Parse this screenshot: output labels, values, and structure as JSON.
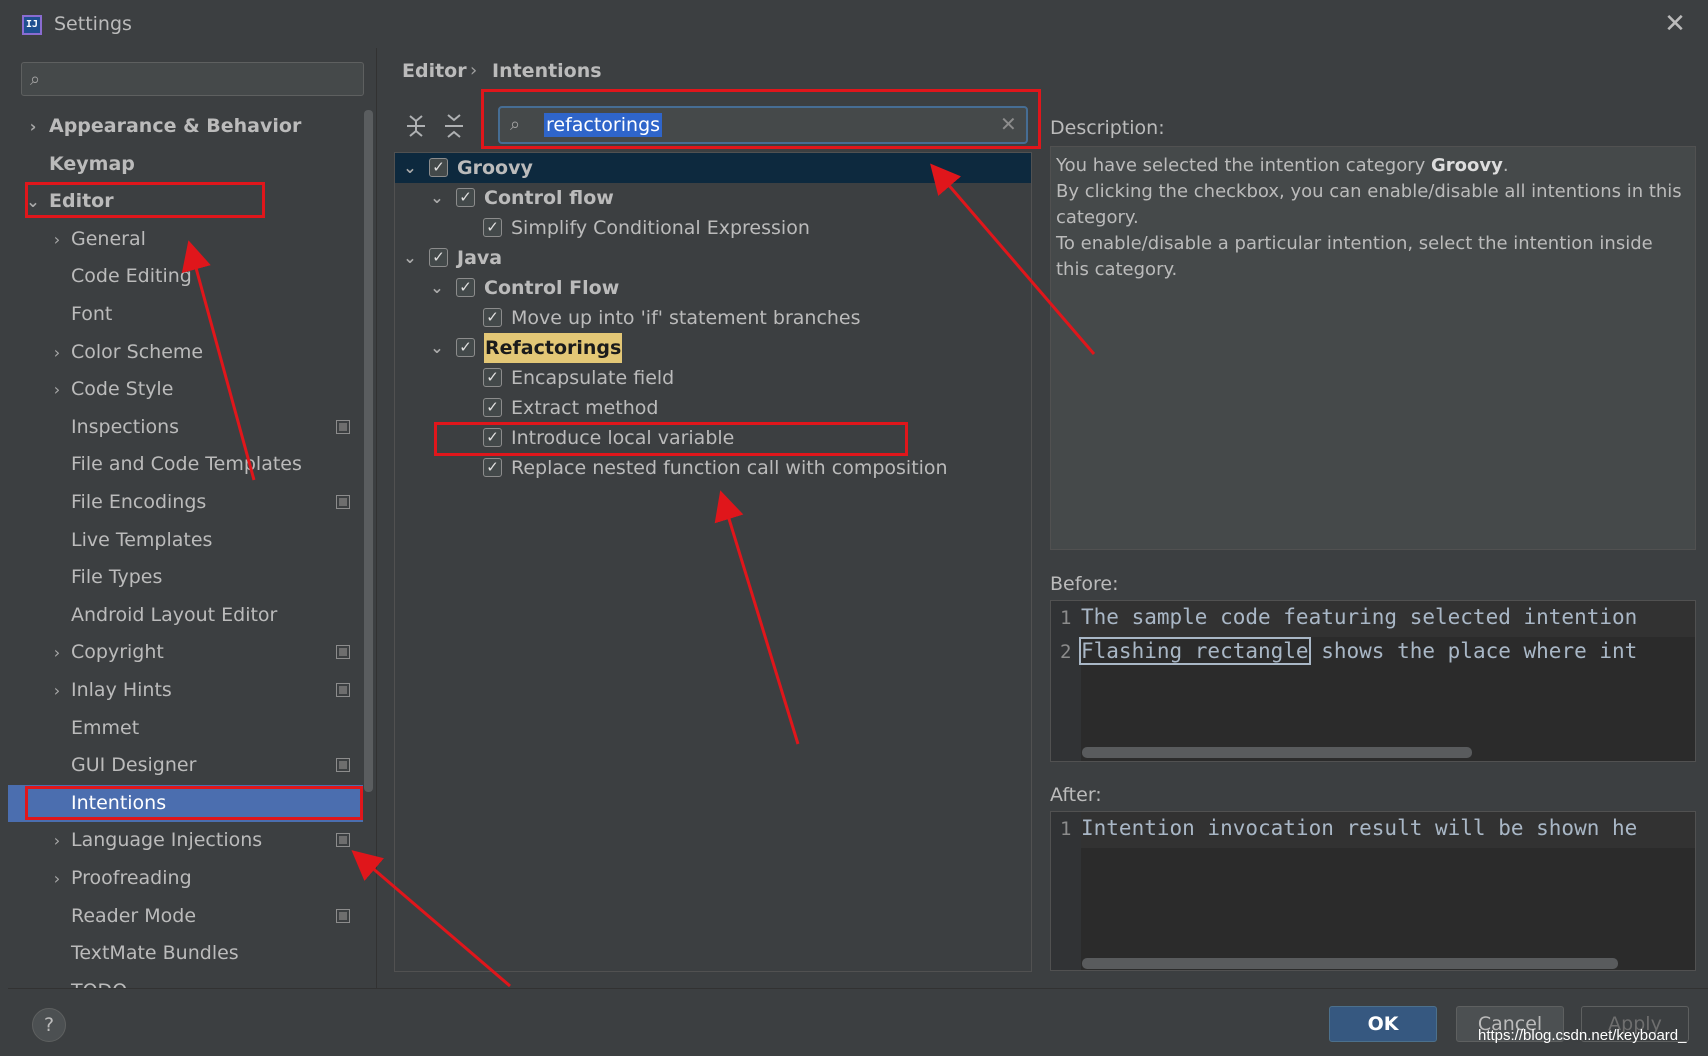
{
  "window": {
    "title": "Settings",
    "app_icon": "IJ",
    "close_glyph": "✕"
  },
  "left": {
    "search_placeholder": "",
    "tree": [
      {
        "label": "Appearance & Behavior",
        "level": 0,
        "bold": true,
        "chevron": "›",
        "icon": false
      },
      {
        "label": "Keymap",
        "level": 0,
        "bold": true,
        "chevron": "",
        "icon": false
      },
      {
        "label": "Editor",
        "level": 0,
        "bold": true,
        "chevron": "⌄",
        "icon": false
      },
      {
        "label": "General",
        "level": 1,
        "bold": false,
        "chevron": "›",
        "icon": false
      },
      {
        "label": "Code Editing",
        "level": 1,
        "bold": false,
        "chevron": "",
        "icon": false
      },
      {
        "label": "Font",
        "level": 1,
        "bold": false,
        "chevron": "",
        "icon": false
      },
      {
        "label": "Color Scheme",
        "level": 1,
        "bold": false,
        "chevron": "›",
        "icon": false
      },
      {
        "label": "Code Style",
        "level": 1,
        "bold": false,
        "chevron": "›",
        "icon": false
      },
      {
        "label": "Inspections",
        "level": 1,
        "bold": false,
        "chevron": "",
        "icon": true
      },
      {
        "label": "File and Code Templates",
        "level": 1,
        "bold": false,
        "chevron": "",
        "icon": false
      },
      {
        "label": "File Encodings",
        "level": 1,
        "bold": false,
        "chevron": "",
        "icon": true
      },
      {
        "label": "Live Templates",
        "level": 1,
        "bold": false,
        "chevron": "",
        "icon": false
      },
      {
        "label": "File Types",
        "level": 1,
        "bold": false,
        "chevron": "",
        "icon": false
      },
      {
        "label": "Android Layout Editor",
        "level": 1,
        "bold": false,
        "chevron": "",
        "icon": false
      },
      {
        "label": "Copyright",
        "level": 1,
        "bold": false,
        "chevron": "›",
        "icon": true
      },
      {
        "label": "Inlay Hints",
        "level": 1,
        "bold": false,
        "chevron": "›",
        "icon": true
      },
      {
        "label": "Emmet",
        "level": 1,
        "bold": false,
        "chevron": "",
        "icon": false
      },
      {
        "label": "GUI Designer",
        "level": 1,
        "bold": false,
        "chevron": "",
        "icon": true
      },
      {
        "label": "Intentions",
        "level": 1,
        "bold": false,
        "chevron": "",
        "icon": false,
        "selected": true
      },
      {
        "label": "Language Injections",
        "level": 1,
        "bold": false,
        "chevron": "›",
        "icon": true
      },
      {
        "label": "Proofreading",
        "level": 1,
        "bold": false,
        "chevron": "›",
        "icon": false
      },
      {
        "label": "Reader Mode",
        "level": 1,
        "bold": false,
        "chevron": "",
        "icon": true
      },
      {
        "label": "TextMate Bundles",
        "level": 1,
        "bold": false,
        "chevron": "",
        "icon": false
      },
      {
        "label": "TODO",
        "level": 1,
        "bold": false,
        "chevron": "",
        "icon": false
      }
    ]
  },
  "breadcrumb": {
    "parent": "Editor",
    "separator": "›",
    "current": "Intentions"
  },
  "filter": {
    "value": "refactorings",
    "clear_glyph": "✕"
  },
  "intentions": [
    {
      "label": "Groovy",
      "level": 0,
      "bold": true,
      "checked": true,
      "chevron": "⌄",
      "selected": true
    },
    {
      "label": "Control flow",
      "level": 1,
      "bold": true,
      "checked": true,
      "chevron": "⌄"
    },
    {
      "label": "Simplify Conditional Expression",
      "level": 2,
      "bold": false,
      "checked": true,
      "chevron": ""
    },
    {
      "label": "Java",
      "level": 0,
      "bold": true,
      "checked": true,
      "chevron": "⌄"
    },
    {
      "label": "Control Flow",
      "level": 1,
      "bold": true,
      "checked": true,
      "chevron": "⌄"
    },
    {
      "label": "Move up into 'if' statement branches",
      "level": 2,
      "bold": false,
      "checked": true,
      "chevron": ""
    },
    {
      "label": "Refactorings",
      "level": 1,
      "bold": true,
      "checked": true,
      "chevron": "⌄",
      "highlight": true
    },
    {
      "label": "Encapsulate field",
      "level": 2,
      "bold": false,
      "checked": true,
      "chevron": ""
    },
    {
      "label": "Extract method",
      "level": 2,
      "bold": false,
      "checked": true,
      "chevron": ""
    },
    {
      "label": "Introduce local variable",
      "level": 2,
      "bold": false,
      "checked": true,
      "chevron": ""
    },
    {
      "label": "Replace nested function call with composition",
      "level": 2,
      "bold": false,
      "checked": true,
      "chevron": ""
    }
  ],
  "description": {
    "label": "Description:",
    "line1_prefix": "You have selected the intention category ",
    "line1_bold": "Groovy",
    "line1_suffix": ".",
    "line2": "By clicking the checkbox, you can enable/disable all intentions in this category.",
    "line3": "To enable/disable a particular intention, select the intention inside this category."
  },
  "before": {
    "label": "Before:",
    "line1_num": "1",
    "line1": "The sample code featuring selected intention",
    "line2_num": "2",
    "line2_flash": "Flashing rectangle",
    "line2_rest": " shows the place where int"
  },
  "after": {
    "label": "After:",
    "line1_num": "1",
    "line1": "Intention invocation result will be shown he"
  },
  "buttons": {
    "help": "?",
    "ok": "OK",
    "cancel": "Cancel",
    "apply": "Apply"
  },
  "watermark": "https://blog.csdn.net/keyboard_",
  "colors": {
    "background": "#3c3f41",
    "selection": "#4b6eaf",
    "annotation": "#e0161b",
    "highlight": "#e3c776"
  }
}
